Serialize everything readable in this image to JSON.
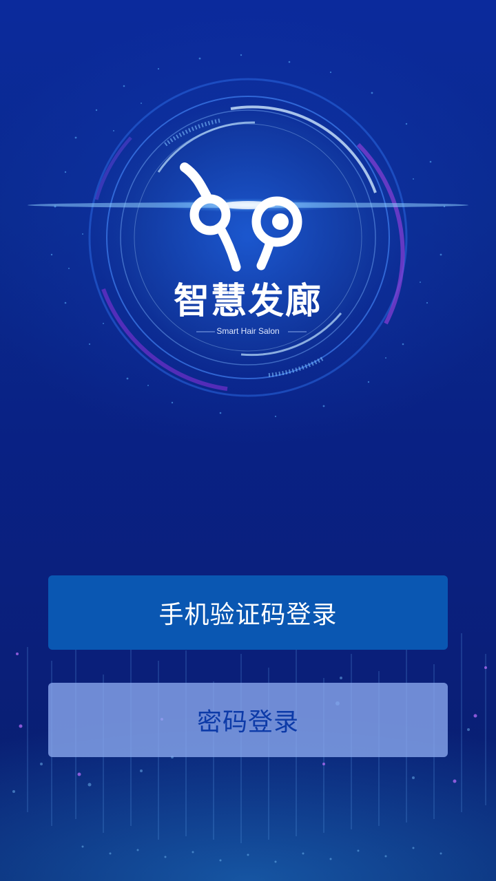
{
  "logo": {
    "title": "智慧发廊",
    "subtitle": "Smart Hair Salon",
    "icon": "scissors-eye-logo-icon"
  },
  "buttons": {
    "sms_login": "手机验证码登录",
    "password_login": "密码登录"
  },
  "colors": {
    "background": "#0a2a8e",
    "sms_button": "#0a57b2",
    "password_button": "#8caaf0",
    "password_button_text": "#0c3aa8"
  }
}
